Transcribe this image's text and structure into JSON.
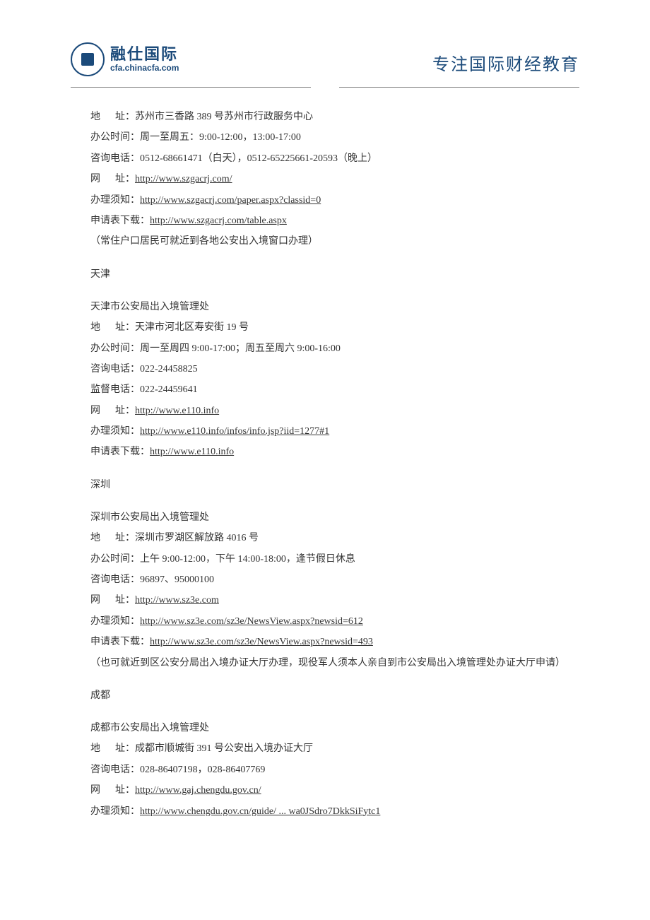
{
  "header": {
    "logo_cn": "融仕国际",
    "logo_url": "cfa.chinacfa.com",
    "slogan": "专注国际财经教育"
  },
  "sections": [
    {
      "lines": [
        {
          "label": "地",
          "labelSpaced": true,
          "suffix": "址：",
          "text": "苏州市三香路 389 号苏州市行政服务中心"
        },
        {
          "label": "办公时间：",
          "text": "周一至周五：9:00-12:00，13:00-17:00"
        },
        {
          "label": "咨询电话：",
          "text": "0512-68661471（白天），0512-65225661-20593（晚上）"
        },
        {
          "label": "网",
          "labelSpaced": true,
          "suffix": "址：",
          "link": "http://www.szgacrj.com/"
        },
        {
          "label": "办理须知：",
          "link": "http://www.szgacrj.com/paper.aspx?classid=0"
        },
        {
          "label": "申请表下载：",
          "link": "http://www.szgacrj.com/table.aspx"
        },
        {
          "text_only": "（常住户口居民可就近到各地公安出入境窗口办理）"
        }
      ]
    },
    {
      "city": "天津",
      "title": "天津市公安局出入境管理处",
      "lines": [
        {
          "label": "地",
          "labelSpaced": true,
          "suffix": "址：",
          "text": "天津市河北区寿安街 19 号"
        },
        {
          "label": "办公时间：",
          "text": "周一至周四 9:00-17:00；周五至周六 9:00-16:00"
        },
        {
          "label": "咨询电话：",
          "text": "022-24458825"
        },
        {
          "label": "监督电话：",
          "text": "022-24459641"
        },
        {
          "label": "网",
          "labelSpaced": true,
          "suffix": "址：",
          "link": "http://www.e110.info"
        },
        {
          "label": "办理须知：",
          "link": "http://www.e110.info/infos/info.jsp?iid=1277#1"
        },
        {
          "label": "申请表下载：",
          "link": "http://www.e110.info"
        }
      ]
    },
    {
      "city": "深圳",
      "title": "深圳市公安局出入境管理处",
      "lines": [
        {
          "label": "地",
          "labelSpaced": true,
          "suffix": "址：",
          "text": "深圳市罗湖区解放路 4016 号"
        },
        {
          "label": "办公时间：",
          "text": "上午 9:00-12:00，下午 14:00-18:00，逢节假日休息"
        },
        {
          "label": "咨询电话：",
          "text": "96897、95000100"
        },
        {
          "label": "网",
          "labelSpaced": true,
          "suffix": "址：",
          "link": "http://www.sz3e.com"
        },
        {
          "label": "办理须知：",
          "link": "http://www.sz3e.com/sz3e/NewsView.aspx?newsid=612"
        },
        {
          "label": "申请表下载：",
          "link": "http://www.sz3e.com/sz3e/NewsView.aspx?newsid=493"
        }
      ],
      "footnote": "（也可就近到区公安分局出入境办证大厅办理，现役军人须本人亲自到市公安局出入境管理处办证大厅申请）"
    },
    {
      "city": "成都",
      "title": "成都市公安局出入境管理处",
      "lines": [
        {
          "label": "地",
          "labelSpaced": true,
          "suffix": "址：",
          "text": "成都市顺城街 391 号公安出入境办证大厅"
        },
        {
          "label": "咨询电话：",
          "text": "028-86407198，028-86407769"
        },
        {
          "label": "网",
          "labelSpaced": true,
          "suffix": "址：",
          "link": "http://www.gaj.chengdu.gov.cn/"
        },
        {
          "label": "办理须知：",
          "link": "http://www.chengdu.gov.cn/guide/ ... wa0JSdro7DkkSiFytc1"
        }
      ]
    }
  ]
}
